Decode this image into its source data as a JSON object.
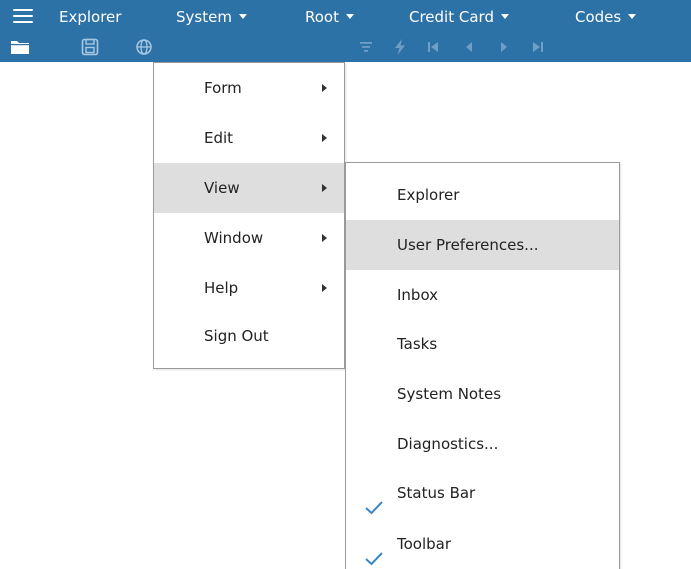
{
  "menubar": {
    "items": [
      {
        "label": "Explorer",
        "has_caret": false
      },
      {
        "label": "System",
        "has_caret": true
      },
      {
        "label": "Root",
        "has_caret": true
      },
      {
        "label": "Credit Card",
        "has_caret": true
      },
      {
        "label": "Codes",
        "has_caret": true
      }
    ],
    "background_color": "#2c72a7"
  },
  "toolbar": {
    "icons": [
      "folder-icon",
      "save-icon",
      "globe-icon",
      "filter-icon",
      "lightning-icon",
      "first-record-icon",
      "previous-record-icon",
      "next-record-icon",
      "last-record-icon"
    ]
  },
  "system_menu": {
    "items": [
      {
        "label": "Form",
        "submenu": true
      },
      {
        "label": "Edit",
        "submenu": true
      },
      {
        "label": "View",
        "submenu": true,
        "highlighted": true
      },
      {
        "label": "Window",
        "submenu": true
      },
      {
        "label": "Help",
        "submenu": true
      },
      {
        "label": "Sign Out",
        "submenu": false
      }
    ]
  },
  "view_submenu": {
    "items": [
      {
        "label": "Explorer",
        "checked": false
      },
      {
        "label": "User Preferences...",
        "checked": false,
        "highlighted": true
      },
      {
        "label": "Inbox",
        "checked": false
      },
      {
        "label": "Tasks",
        "checked": false
      },
      {
        "label": "System Notes",
        "checked": false
      },
      {
        "label": "Diagnostics...",
        "checked": false
      },
      {
        "label": "Status Bar",
        "checked": true
      },
      {
        "label": "Toolbar",
        "checked": true
      }
    ],
    "check_color": "#3a86c8",
    "highlight_color": "#dedede"
  }
}
